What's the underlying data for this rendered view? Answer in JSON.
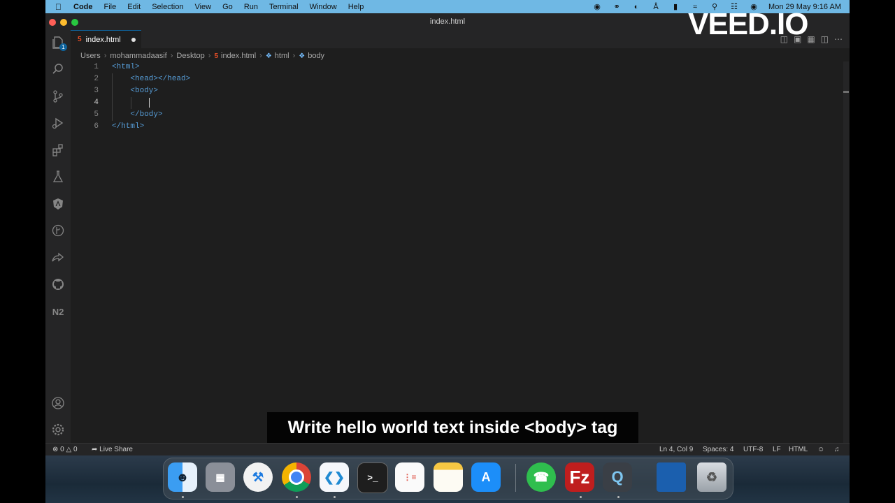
{
  "menubar": {
    "items": [
      "Code",
      "File",
      "Edit",
      "Selection",
      "View",
      "Go",
      "Run",
      "Terminal",
      "Window",
      "Help"
    ],
    "clock": "Mon 29 May  9:16 AM"
  },
  "window": {
    "title": "index.html"
  },
  "activity": {
    "badge": "1"
  },
  "tab": {
    "label": "index.html",
    "icon": "html5-icon"
  },
  "breadcrumb": [
    "Users",
    "mohammadaasif",
    "Desktop",
    "index.html",
    "html",
    "body"
  ],
  "editor": {
    "lines": [
      {
        "num": "1",
        "indent": "",
        "text": "<html>"
      },
      {
        "num": "2",
        "indent": "    ",
        "text": "<head></head>"
      },
      {
        "num": "3",
        "indent": "    ",
        "text": "<body>"
      },
      {
        "num": "4",
        "indent": "        ",
        "text": ""
      },
      {
        "num": "5",
        "indent": "    ",
        "text": "</body>"
      },
      {
        "num": "6",
        "indent": "",
        "text": "</html>"
      }
    ],
    "current_line": "4"
  },
  "status": {
    "errors": "0",
    "warnings": "0",
    "live_share": "Live Share",
    "position": "Ln 4, Col 9",
    "spaces": "Spaces: 4",
    "encoding": "UTF-8",
    "eol": "LF",
    "language": "HTML"
  },
  "dock": {
    "apps": [
      "finder-icon",
      "launchpad-icon",
      "xcode-icon",
      "chrome-icon",
      "vscode-icon",
      "terminal-icon",
      "reminders-icon",
      "notes-icon",
      "app-store-icon",
      "whatsapp-icon",
      "filezilla-icon",
      "quicktime-icon",
      "downloads-folder-icon",
      "trash-icon"
    ]
  },
  "overlay": {
    "caption": "Write hello world text inside <body> tag",
    "watermark": "VEED.IO"
  },
  "colors": {
    "menubar": "#6fb8e4",
    "editor_bg": "#1e1e1e",
    "tag": "#569cd6",
    "accent": "#0e639c"
  }
}
